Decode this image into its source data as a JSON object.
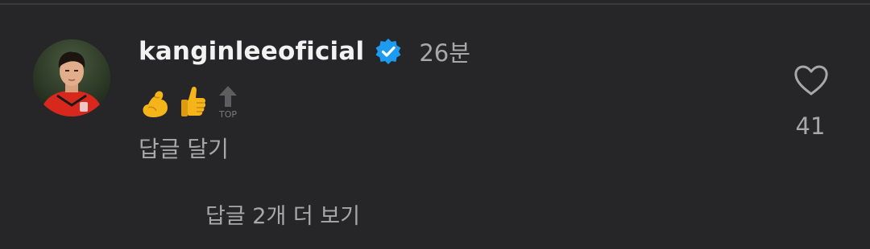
{
  "comment": {
    "username": "kanginleeoficial",
    "verified": true,
    "timestamp": "26분",
    "emojis": [
      "flexed-biceps",
      "thumbs-up",
      "top-arrow"
    ],
    "reply_label": "답글 달기",
    "view_more_replies": "답글 2개 더 보기"
  },
  "like": {
    "count": "41"
  },
  "colors": {
    "background": "#262628",
    "primary_text": "#f2f2f2",
    "secondary_text": "#a8a8a8",
    "verified_badge": "#1d9bf0"
  }
}
